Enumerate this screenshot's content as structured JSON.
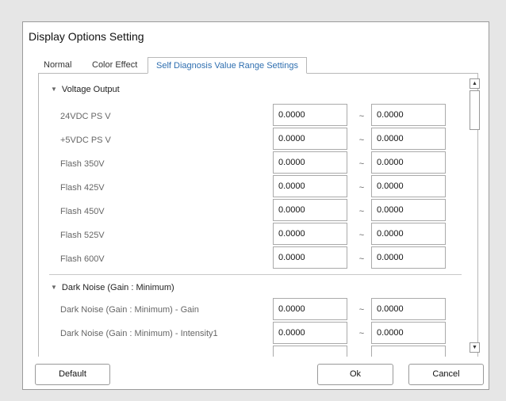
{
  "dialog": {
    "title": "Display Options Setting",
    "tabs": [
      {
        "label": "Normal"
      },
      {
        "label": "Color Effect"
      },
      {
        "label": "Self Diagnosis Value Range Settings",
        "active": true
      }
    ],
    "sections": [
      {
        "title": "Voltage Output",
        "rows": [
          {
            "label": "24VDC PS V",
            "min": "0.0000",
            "max": "0.0000"
          },
          {
            "label": "+5VDC PS V",
            "min": "0.0000",
            "max": "0.0000"
          },
          {
            "label": "Flash 350V",
            "min": "0.0000",
            "max": "0.0000"
          },
          {
            "label": "Flash 425V",
            "min": "0.0000",
            "max": "0.0000"
          },
          {
            "label": "Flash 450V",
            "min": "0.0000",
            "max": "0.0000"
          },
          {
            "label": "Flash 525V",
            "min": "0.0000",
            "max": "0.0000"
          },
          {
            "label": "Flash 600V",
            "min": "0.0000",
            "max": "0.0000"
          }
        ]
      },
      {
        "title": "Dark Noise (Gain : Minimum)",
        "rows": [
          {
            "label": "Dark Noise (Gain : Minimum) - Gain",
            "min": "0.0000",
            "max": "0.0000"
          },
          {
            "label": "Dark Noise (Gain : Minimum) - Intensity1",
            "min": "0.0000",
            "max": "0.0000"
          },
          {
            "label": "",
            "min": "",
            "max": ""
          }
        ]
      }
    ],
    "range_separator": "~",
    "buttons": {
      "default": "Default",
      "ok": "Ok",
      "cancel": "Cancel"
    }
  },
  "icons": {
    "section_toggle": "triangle-down-icon",
    "scroll_up": "arrow-up-icon",
    "scroll_down": "arrow-down-icon"
  }
}
